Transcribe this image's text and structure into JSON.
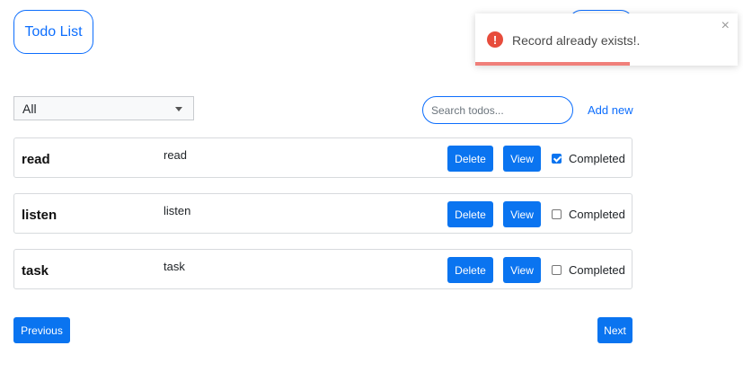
{
  "header": {
    "title": "Todo List"
  },
  "toolbar": {
    "filter_selected": "All",
    "search_placeholder": "Search todos...",
    "add_new_label": "Add new"
  },
  "todos": [
    {
      "name": "read",
      "description": "read",
      "delete_label": "Delete",
      "view_label": "View",
      "completed": true,
      "completed_label": "Completed"
    },
    {
      "name": "listen",
      "description": "listen",
      "delete_label": "Delete",
      "view_label": "View",
      "completed": false,
      "completed_label": "Completed"
    },
    {
      "name": "task",
      "description": "task",
      "delete_label": "Delete",
      "view_label": "View",
      "completed": false,
      "completed_label": "Completed"
    }
  ],
  "pagination": {
    "previous_label": "Previous",
    "next_label": "Next"
  },
  "toast": {
    "message": "Record already exists!.",
    "close_symbol": "×",
    "icon_symbol": "!",
    "type": "error",
    "progress": 0.59,
    "icon": "error-circle-icon"
  },
  "colors": {
    "accent": "#0d6efd",
    "button": "#0a74f0",
    "error": "#e74c3c",
    "progress": "#f07f7a"
  }
}
